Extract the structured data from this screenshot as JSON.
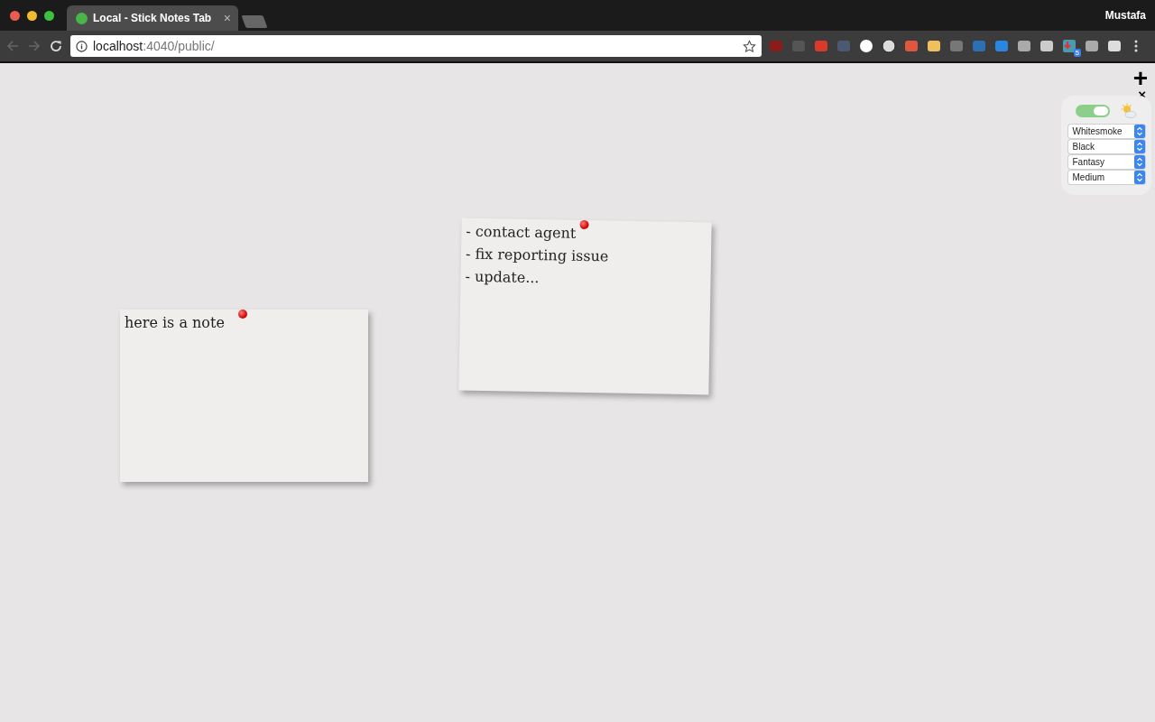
{
  "browser": {
    "tab": {
      "title": "Local - Stick Notes Tab",
      "close": "×"
    },
    "user": "Mustafa",
    "address": {
      "host": "localhost",
      "rest": ":4040/public/"
    },
    "extension_badge": "5"
  },
  "settings": {
    "add": "+",
    "close": "×",
    "toggle": {
      "on": true
    },
    "selects": [
      {
        "value": "Whitesmoke"
      },
      {
        "value": "Black"
      },
      {
        "value": "Fantasy"
      },
      {
        "value": "Medium"
      }
    ]
  },
  "notes": [
    {
      "lines": [
        "here is a note"
      ],
      "tilted": false
    },
    {
      "lines": [
        "- contact agent",
        "- fix reporting issue",
        "- update..."
      ],
      "tilted": true
    }
  ]
}
